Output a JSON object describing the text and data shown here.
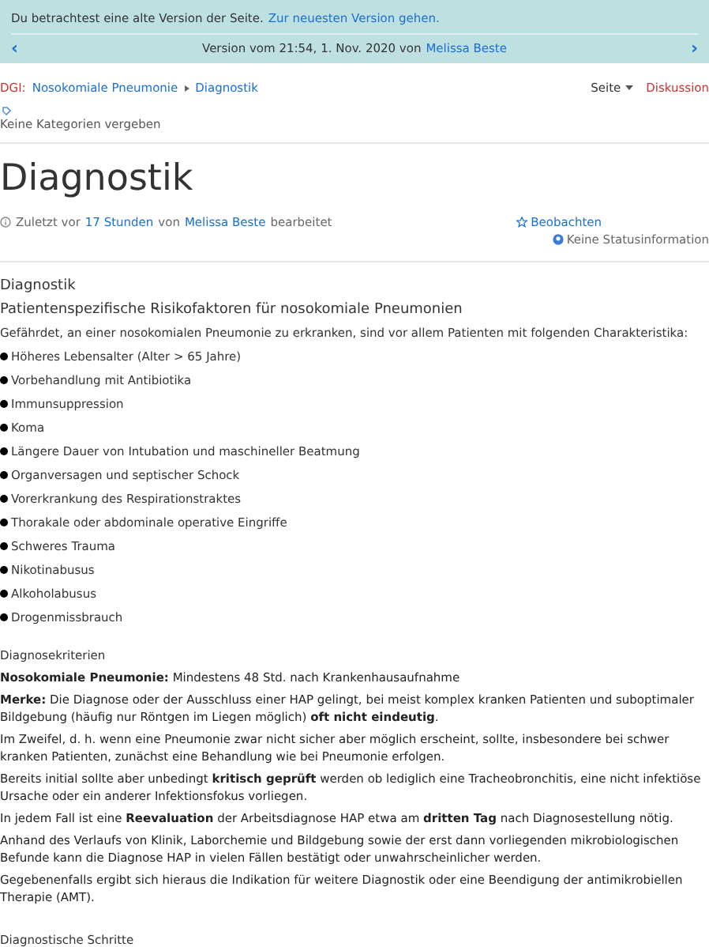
{
  "banner": {
    "message": "Du betrachtest eine alte Version der Seite.",
    "link": "Zur neuesten Version gehen.",
    "version_prefix": "Version vom 21:54, 1. Nov. 2020 von",
    "version_author": "Melissa Beste",
    "prev": "‹",
    "next": "›"
  },
  "breadcrumb": {
    "space": "DGI:",
    "items": [
      "Nosokomiale Pneumonie",
      "Diagnostik"
    ]
  },
  "page_menu": {
    "label": "Seite",
    "discussion": "Diskussion"
  },
  "categories": "Keine Kategorien vergeben",
  "title": "Diagnostik",
  "meta": {
    "prefix": "Zuletzt vor",
    "time": "17 Stunden",
    "middle": "von",
    "author": "Melissa Beste",
    "suffix": "bearbeitet",
    "watch": "Beobachten",
    "status": "Keine Statusinformation"
  },
  "content": {
    "heading": "Diagnostik",
    "subheading": "Patientenspezifische Risikofaktoren für nosokomiale Pneumonien",
    "intro": "Gefährdet, an einer nosokomialen Pneumonie zu erkranken, sind vor allem Patienten mit folgenden Charakteristika:",
    "bullets": [
      "Höheres Lebensalter (Alter > 65 Jahre)",
      "Vorbehandlung mit Antibiotika",
      "Immunsuppression",
      "Koma",
      "Längere Dauer von Intubation und maschineller Beatmung",
      "Organversagen und septischer Schock",
      "Vorerkrankung des Respirationstraktes",
      "Thorakale oder abdominale operative Eingriffe",
      "Schweres Trauma",
      "Nikotinabusus",
      "Alkoholabusus",
      "Drogenmissbrauch"
    ],
    "section": "Diagnosekriterien",
    "paragraphs": [
      "**Nosokomiale Pneumonie:** Mindestens 48 Std. nach Krankenhausaufnahme",
      "**Merke:** Die Diagnose oder der Ausschluss einer HAP gelingt, bei meist komplex kranken Patienten und suboptimaler Bildgebung (häufig nur Röntgen im Liegen möglich) **oft nicht eindeutig**.",
      "Im Zweifel, d. h. wenn eine Pneumonie zwar nicht sicher aber möglich erscheint, sollte, insbesondere bei schwer kranken Patienten, zunächst eine Behandlung wie bei Pneumonie erfolgen.",
      "Bereits initial sollte aber unbedingt **kritisch geprüft** werden ob lediglich eine Tracheobronchitis, eine nicht infektiöse Ursache oder ein anderer Infektionsfokus vorliegen.",
      "In jedem Fall ist eine **Reevaluation** der Arbeitsdiagnose HAP etwa am **dritten Tag** nach Diagnosestellung nötig.",
      "Anhand des Verlaufs von Klinik, Laborchemie und Bildgebung sowie der erst dann vorliegenden mikrobiologischen Befunde kann die Diagnose HAP in vielen Fällen bestätigt oder unwahrscheinlicher werden.",
      "Gegebenenfalls ergibt sich hieraus die Indikation für weitere Diagnostik oder eine Beendigung der antimikrobiellen Therapie (AMT)."
    ],
    "next_section": "Diagnostische Schritte"
  }
}
